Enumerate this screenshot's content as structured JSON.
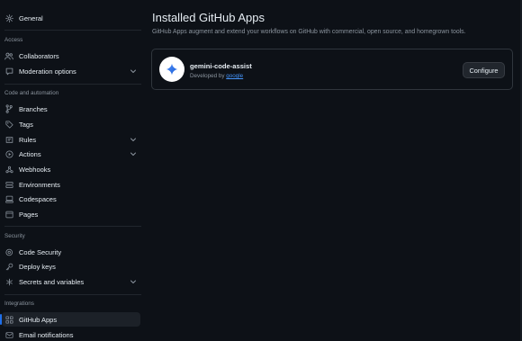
{
  "sidebar": {
    "general": {
      "label": "General",
      "icon": "gear-icon"
    },
    "sections": {
      "access": "Access",
      "code_automation": "Code and automation",
      "security": "Security",
      "integrations": "Integrations"
    },
    "items": {
      "collaborators": {
        "label": "Collaborators",
        "icon": "people-icon"
      },
      "moderation": {
        "label": "Moderation options",
        "icon": "comment-icon"
      },
      "branches": {
        "label": "Branches",
        "icon": "branch-icon"
      },
      "tags": {
        "label": "Tags",
        "icon": "tag-icon"
      },
      "rules": {
        "label": "Rules",
        "icon": "rules-icon"
      },
      "actions": {
        "label": "Actions",
        "icon": "play-icon"
      },
      "webhooks": {
        "label": "Webhooks",
        "icon": "webhook-icon"
      },
      "environments": {
        "label": "Environments",
        "icon": "server-icon"
      },
      "codespaces": {
        "label": "Codespaces",
        "icon": "codespaces-icon"
      },
      "pages": {
        "label": "Pages",
        "icon": "browser-icon"
      },
      "code_security": {
        "label": "Code Security",
        "icon": "shield-icon"
      },
      "deploy_keys": {
        "label": "Deploy keys",
        "icon": "key-icon"
      },
      "secrets": {
        "label": "Secrets and variables",
        "icon": "asterisk-icon"
      },
      "github_apps": {
        "label": "GitHub Apps",
        "icon": "apps-icon",
        "active": true
      },
      "email_notifications": {
        "label": "Email notifications",
        "icon": "mail-icon"
      }
    }
  },
  "main": {
    "title": "Installed GitHub Apps",
    "description": "GitHub Apps augment and extend your workflows on GitHub with commercial, open source, and homegrown tools.",
    "apps": [
      {
        "name": "gemini-code-assist",
        "developed_by_prefix": "Developed by",
        "developer": "google",
        "configure_label": "Configure",
        "icon": "gemini-sparkle-icon"
      }
    ]
  },
  "colors": {
    "background": "#0d1117",
    "text": "#e6edf3",
    "muted": "#8b949e",
    "accent": "#1f6feb",
    "link": "#4493f8",
    "border": "#30363d"
  }
}
